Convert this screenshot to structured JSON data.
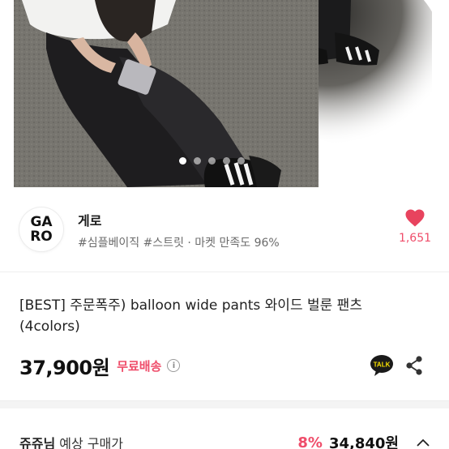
{
  "gallery": {
    "dots_total": 5,
    "active_index": 0
  },
  "shop": {
    "logo_line1": "GA",
    "logo_line2": "RO",
    "name": "게로",
    "tags": "#심플베이직 #스트릿 · 마켓 만족도 96%",
    "like_count": "1,651",
    "heart_icon": "heart-icon"
  },
  "product": {
    "title": "[BEST] 주문폭주) balloon wide pants 와이드 벌룬 팬츠 (4colors)",
    "price": "37,900원",
    "shipping": "무료배송",
    "info_icon_glyph": "i",
    "talk_icon_label": "TALK"
  },
  "expected_price": {
    "user": "쥬쥬님",
    "label": "예상 구매가",
    "discount": "8%",
    "price": "34,840원"
  },
  "colors": {
    "accent": "#ef4d6a",
    "talk": "#f9e000"
  }
}
